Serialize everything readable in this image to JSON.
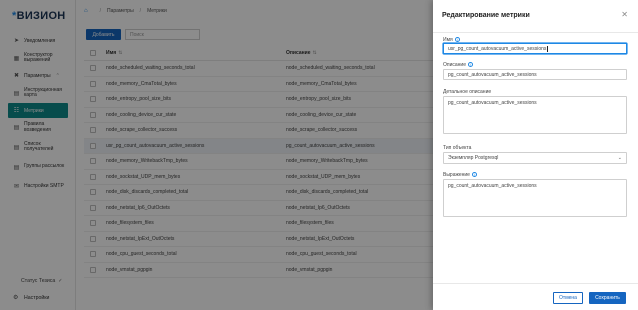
{
  "app": {
    "logo": "ВИЗИОН"
  },
  "sidebar": {
    "items": [
      {
        "label": "Уведомления",
        "icon": "send-icon"
      },
      {
        "label": "Конструктор выражений",
        "icon": "puzzle-icon"
      },
      {
        "label": "Параметры",
        "icon": "tools-icon",
        "expandable": true
      },
      {
        "label": "Инструкционная карта",
        "icon": "map-icon"
      },
      {
        "label": "Метрики",
        "icon": "metrics-icon",
        "active": true
      },
      {
        "label": "Правила возведения",
        "icon": "rules-icon"
      },
      {
        "label": "Список получателей",
        "icon": "recipients-icon"
      },
      {
        "label": "Группы рассылок",
        "icon": "groups-icon"
      },
      {
        "label": "Настройки SMTP",
        "icon": "mail-icon"
      }
    ],
    "status": "Статус Тезиса",
    "settings": "Настройки"
  },
  "breadcrumb": {
    "items": [
      "Параметры",
      "Метрики"
    ]
  },
  "toolbar": {
    "add_label": "Добавить",
    "search_placeholder": "Поиск"
  },
  "table": {
    "columns": [
      "Имя",
      "Описание"
    ],
    "rows": [
      {
        "name": "node_scheduled_waiting_seconds_total",
        "desc": "node_scheduled_waiting_seconds_total"
      },
      {
        "name": "node_memory_CmaTotal_bytes",
        "desc": "node_memory_CmaTotal_bytes"
      },
      {
        "name": "node_entropy_pool_size_bits",
        "desc": "node_entropy_pool_size_bits"
      },
      {
        "name": "node_cooling_device_cur_state",
        "desc": "node_cooling_device_cur_state"
      },
      {
        "name": "node_scrape_collector_success",
        "desc": "node_scrape_collector_success"
      },
      {
        "name": "usr_pg_count_autovacuum_active_sessions",
        "desc": "pg_count_autovacuum_active_sessions",
        "highlight": true
      },
      {
        "name": "node_memory_WritebackTmp_bytes",
        "desc": "node_memory_WritebackTmp_bytes"
      },
      {
        "name": "node_sockstat_UDP_mem_bytes",
        "desc": "node_sockstat_UDP_mem_bytes"
      },
      {
        "name": "node_disk_discards_completed_total",
        "desc": "node_disk_discards_completed_total"
      },
      {
        "name": "node_netstat_Ip6_OutOctets",
        "desc": "node_netstat_Ip6_OutOctets"
      },
      {
        "name": "node_filesystem_files",
        "desc": "node_filesystem_files"
      },
      {
        "name": "node_netstat_IpExt_OutOctets",
        "desc": "node_netstat_IpExt_OutOctets"
      },
      {
        "name": "node_cpu_guest_seconds_total",
        "desc": "node_cpu_guest_seconds_total"
      },
      {
        "name": "node_vmstat_pgpgin",
        "desc": "node_vmstat_pgpgin"
      }
    ]
  },
  "drawer": {
    "title": "Редактирование метрики",
    "name_label": "Имя",
    "name_value": "usr_pg_count_autovacuum_active_sessions",
    "desc_label": "Описание",
    "desc_value": "pg_count_autovacuum_active_sessions",
    "detail_label": "Детальное описание",
    "detail_value": "pg_count_autovacuum_active_sessions",
    "object_type_label": "Тип объекта",
    "object_type_value": "Экземпляр Postgresql",
    "expr_label": "Выражение",
    "expr_value": "pg_count_autovacuum_active_sessions",
    "cancel_label": "Отмена",
    "save_label": "Сохранить"
  },
  "colors": {
    "primary": "#1565c0",
    "active_nav": "#0e8a8a",
    "focus": "#1e88e5"
  }
}
